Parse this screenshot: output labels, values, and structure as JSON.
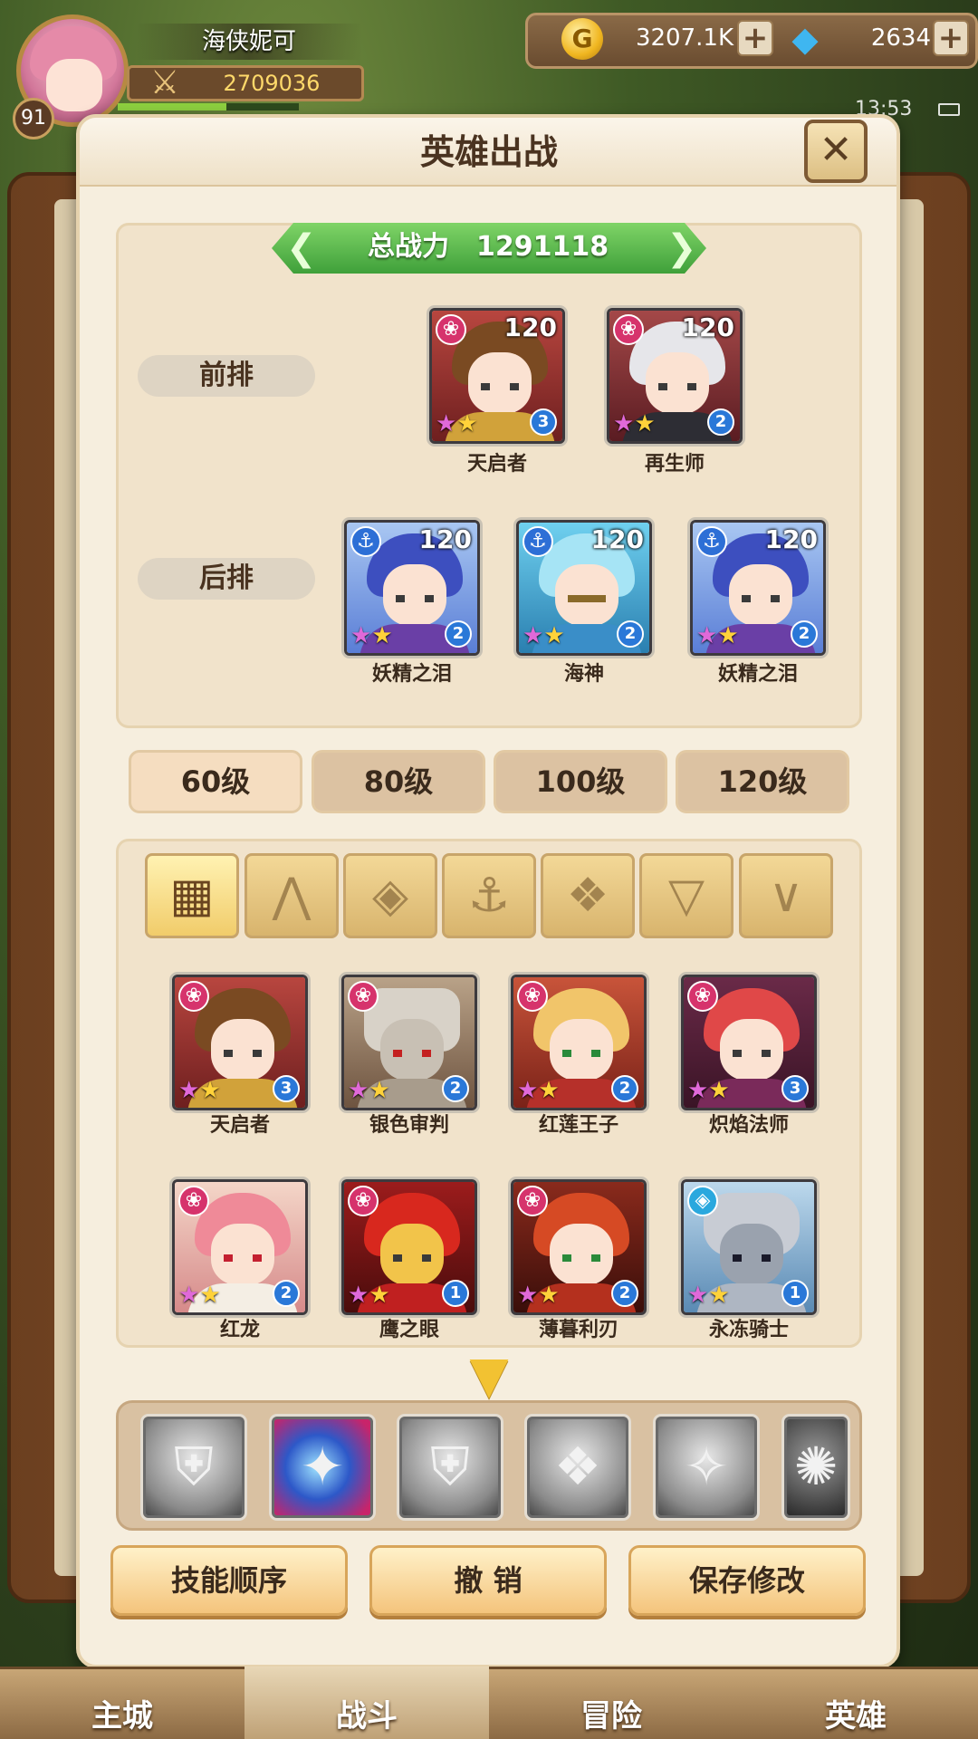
{
  "player": {
    "name": "海侠妮可",
    "level": "91",
    "power": "2709036",
    "exp_fraction": 0.6
  },
  "resources": {
    "gold": "3207.1K",
    "gems": "2634",
    "gold_icon": "G",
    "plus": "+"
  },
  "status": {
    "time": "13:53"
  },
  "dialog": {
    "title": "英雄出战",
    "close_icon": "✕"
  },
  "total_power": {
    "label": "总战力",
    "value": "1291118",
    "left_arrow": "❮",
    "right_arrow": "❯"
  },
  "formation": {
    "front_label": "前排",
    "back_label": "后排",
    "front": [
      {
        "name": "天启者",
        "level": "120",
        "grade": "3",
        "class_icon": "❀",
        "stars": 2
      },
      {
        "name": "再生师",
        "level": "120",
        "grade": "2",
        "class_icon": "❀",
        "stars": 2
      }
    ],
    "back": [
      {
        "name": "妖精之泪",
        "level": "120",
        "grade": "2",
        "class_icon": "⚓",
        "stars": 2
      },
      {
        "name": "海神",
        "level": "120",
        "grade": "2",
        "class_icon": "⚓",
        "stars": 2
      },
      {
        "name": "妖精之泪",
        "level": "120",
        "grade": "2",
        "class_icon": "⚓",
        "stars": 2
      }
    ]
  },
  "level_tabs": [
    "60级",
    "80级",
    "100级",
    "120级"
  ],
  "filters": {
    "all_icon": "▦",
    "icons": [
      "⋀",
      "◈",
      "⚓",
      "❖",
      "▽",
      "∨"
    ]
  },
  "roster": [
    {
      "name": "天启者",
      "grade": "3",
      "class_icon": "❀"
    },
    {
      "name": "银色审判",
      "grade": "2",
      "class_icon": "❀"
    },
    {
      "name": "红莲王子",
      "grade": "2",
      "class_icon": "❀"
    },
    {
      "name": "炽焰法师",
      "grade": "3",
      "class_icon": "❀"
    },
    {
      "name": "红龙",
      "grade": "2",
      "class_icon": "❀"
    },
    {
      "name": "鹰之眼",
      "grade": "1",
      "class_icon": "❀"
    },
    {
      "name": "薄暮利刃",
      "grade": "2",
      "class_icon": "❀"
    },
    {
      "name": "永冻骑士",
      "grade": "1",
      "class_icon": "◈"
    }
  ],
  "scroll_icon": "▼",
  "skills": [
    "⛨",
    "✦",
    "⛨",
    "❖",
    "✧",
    "✺"
  ],
  "actions": {
    "skill_order": "技能顺序",
    "undo": "撤 销",
    "save": "保存修改"
  },
  "bottom_nav": [
    "主城",
    "战斗",
    "冒险",
    "英雄"
  ],
  "colors": {
    "accent_green": "#3fa03a",
    "gold": "#f0b620",
    "class_pink": "#d6336c",
    "class_blue": "#2d6fd6"
  }
}
